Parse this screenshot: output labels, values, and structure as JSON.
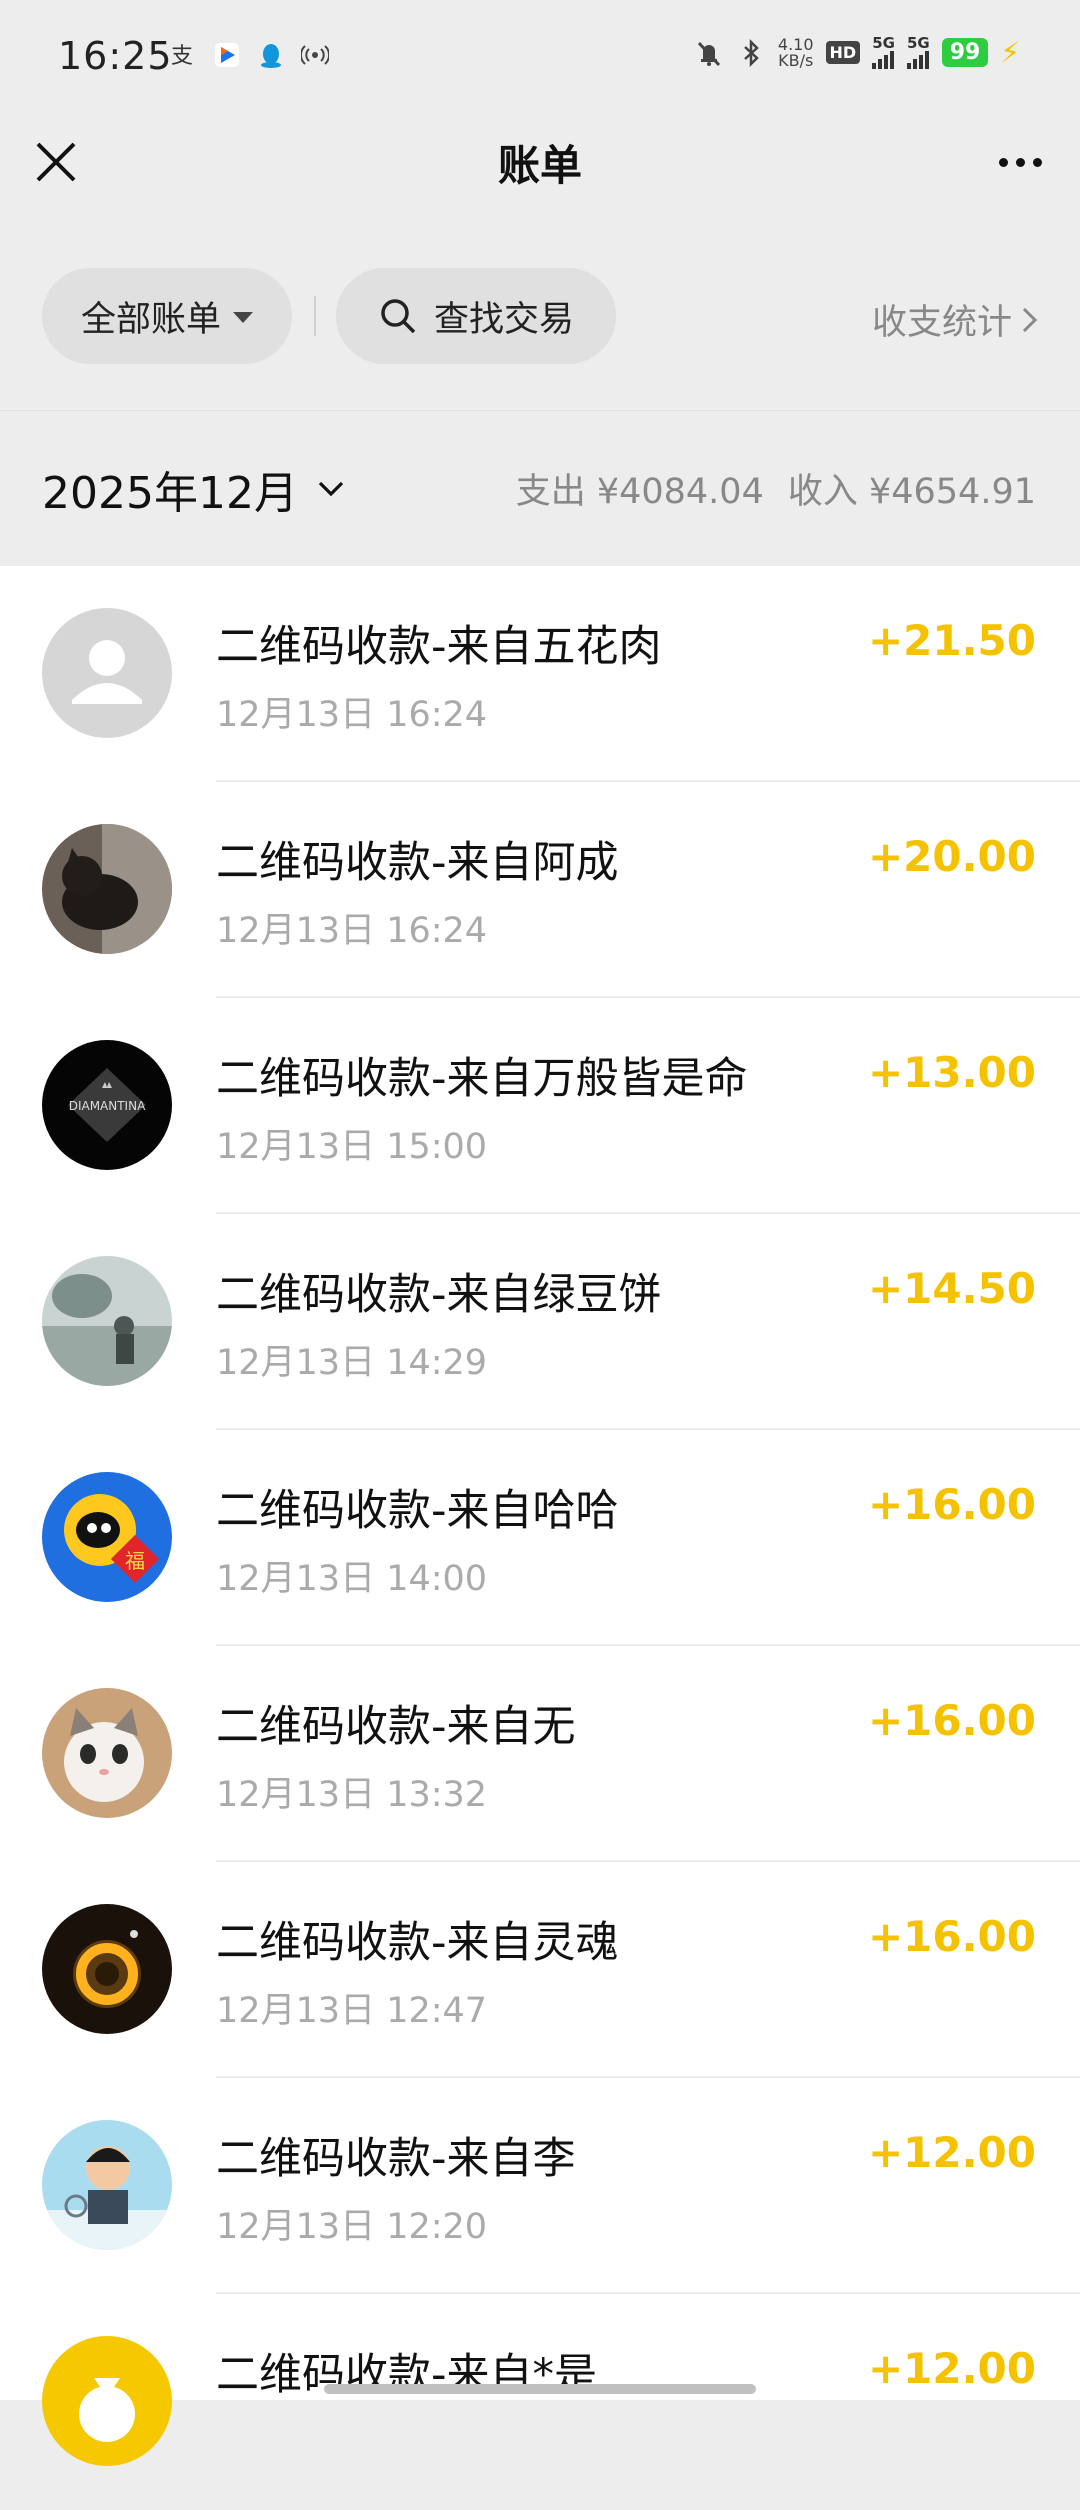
{
  "status_bar": {
    "time": "16:25",
    "net_speed_value": "4.10",
    "net_speed_unit": "KB/s",
    "hd_label": "HD",
    "sim1_label": "5G",
    "sim2_label": "5G",
    "battery": "99"
  },
  "nav": {
    "title": "账单"
  },
  "filters": {
    "all_bills_label": "全部账单",
    "search_label": "查找交易",
    "stats_label": "收支统计"
  },
  "month": {
    "label": "2025年12月",
    "expense": "支出 ¥4084.04",
    "income": "收入 ¥4654.91"
  },
  "bills": [
    {
      "title": "二维码收款-来自五花肉",
      "time": "12月13日 16:24",
      "amount": "+21.50",
      "avatar": "default-user"
    },
    {
      "title": "二维码收款-来自阿成",
      "time": "12月13日 16:24",
      "amount": "+20.00",
      "avatar": "dark-cat"
    },
    {
      "title": "二维码收款-来自万般皆是命",
      "time": "12月13日 15:00",
      "amount": "+13.00",
      "avatar": "diamantina-logo",
      "avatar_text": "DIAMANTINA"
    },
    {
      "title": "二维码收款-来自绿豆饼",
      "time": "12月13日 14:29",
      "amount": "+14.50",
      "avatar": "misty-scene"
    },
    {
      "title": "二维码收款-来自哈哈",
      "time": "12月13日 14:00",
      "amount": "+16.00",
      "avatar": "qq-penguin-fu",
      "avatar_text": "福"
    },
    {
      "title": "二维码收款-来自无",
      "time": "12月13日 13:32",
      "amount": "+16.00",
      "avatar": "white-kitten"
    },
    {
      "title": "二维码收款-来自灵魂",
      "time": "12月13日 12:47",
      "amount": "+16.00",
      "avatar": "golden-ring"
    },
    {
      "title": "二维码收款-来自李",
      "time": "12月13日 12:20",
      "amount": "+12.00",
      "avatar": "cartoon-boy"
    },
    {
      "title": "二维码收款-来自*是",
      "time": "",
      "amount": "+12.00",
      "avatar": "yellow-bag"
    }
  ],
  "colors": {
    "background": "#ededed",
    "list_background": "#ffffff",
    "income_amount": "#f5c200",
    "secondary_text": "#888888"
  }
}
